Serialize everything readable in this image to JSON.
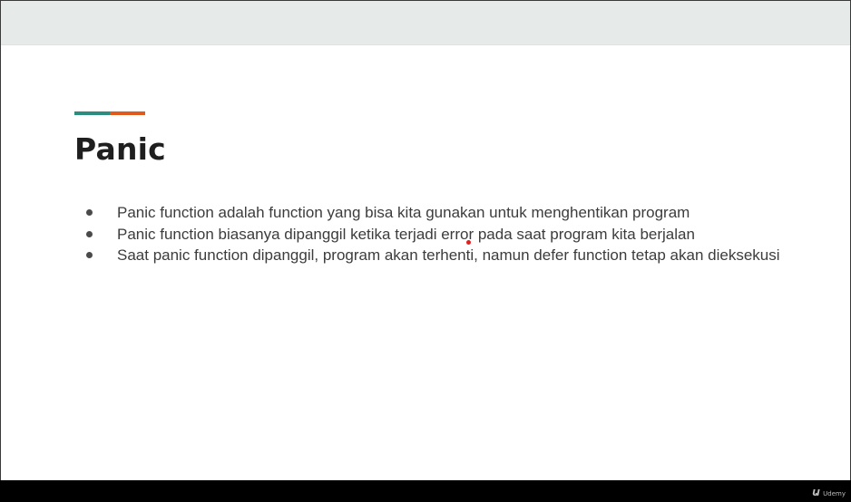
{
  "colors": {
    "accent_teal": "#2b8c80",
    "accent_orange": "#e05a1c",
    "title_color": "#1f1f1f",
    "text_color": "#3c3c3c"
  },
  "slide": {
    "title": "Panic",
    "bullets": [
      "Panic function adalah function yang bisa kita gunakan untuk menghentikan program",
      "Panic function biasanya dipanggil ketika terjadi error pada saat program kita berjalan",
      "Saat panic function dipanggil, program akan terhenti, namun defer function tetap akan dieksekusi"
    ]
  },
  "footer": {
    "brand_logo": "Ա",
    "brand_name": "Udemy"
  }
}
